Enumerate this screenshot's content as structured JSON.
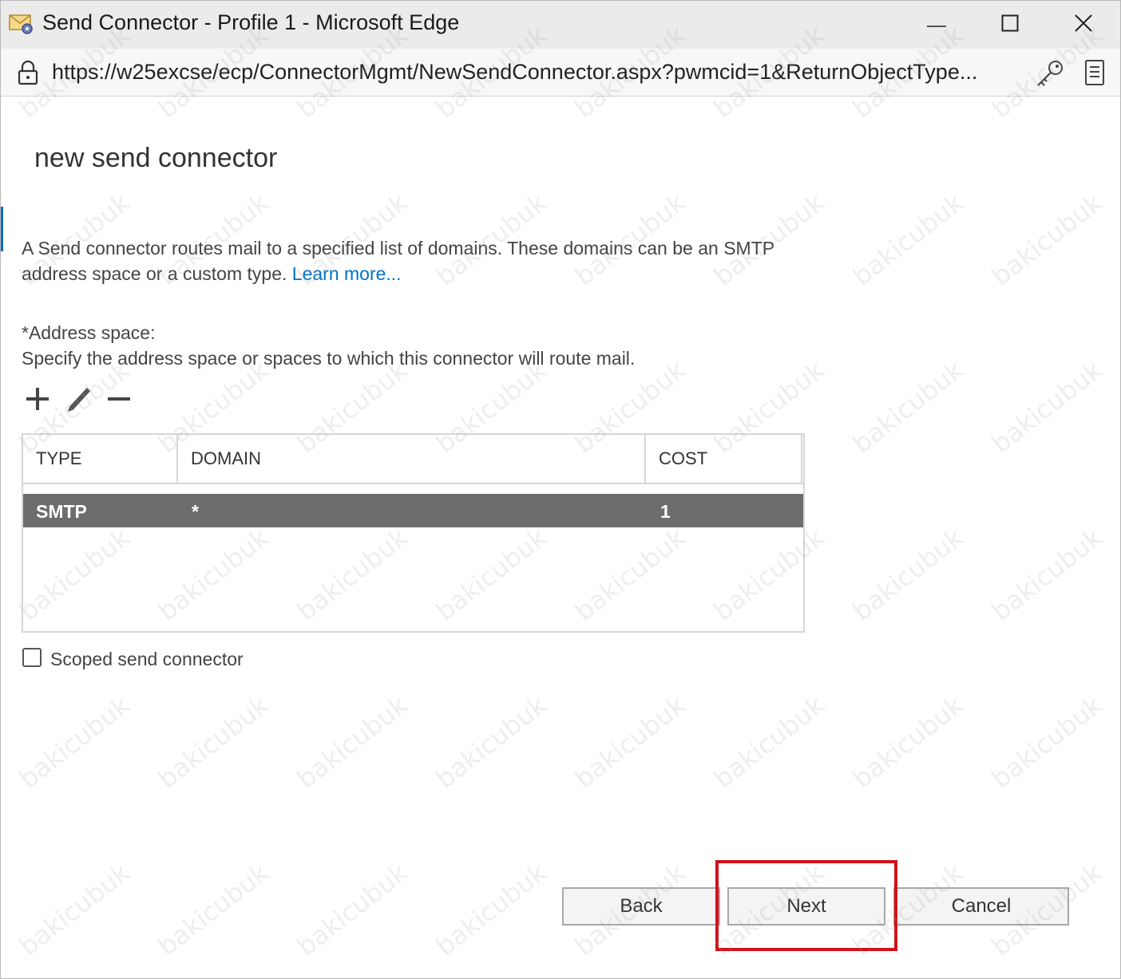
{
  "window": {
    "title": "Send Connector - Profile 1 - Microsoft Edge",
    "url": "https://w25excse/ecp/ConnectorMgmt/NewSendConnector.aspx?pwmcid=1&ReturnObjectType..."
  },
  "page": {
    "title": "new send connector",
    "intro_text": "A Send connector routes mail to a specified list of domains. These domains can be an SMTP address space or a custom type.",
    "learn_more": "Learn more...",
    "address_space_label": "*Address space:",
    "address_space_desc": "Specify the address space or spaces to which this connector will route mail."
  },
  "table": {
    "columns": [
      "TYPE",
      "DOMAIN",
      "COST"
    ],
    "rows": [
      {
        "type": "SMTP",
        "domain": "*",
        "cost": "1"
      }
    ]
  },
  "checkbox": {
    "label": "Scoped send connector",
    "checked": false
  },
  "buttons": {
    "back": "Back",
    "next": "Next",
    "cancel": "Cancel"
  },
  "watermark": "bakicubuk",
  "colors": {
    "link": "#0072c6",
    "selected_row": "#6d6d6d",
    "highlight": "#d0121b"
  }
}
